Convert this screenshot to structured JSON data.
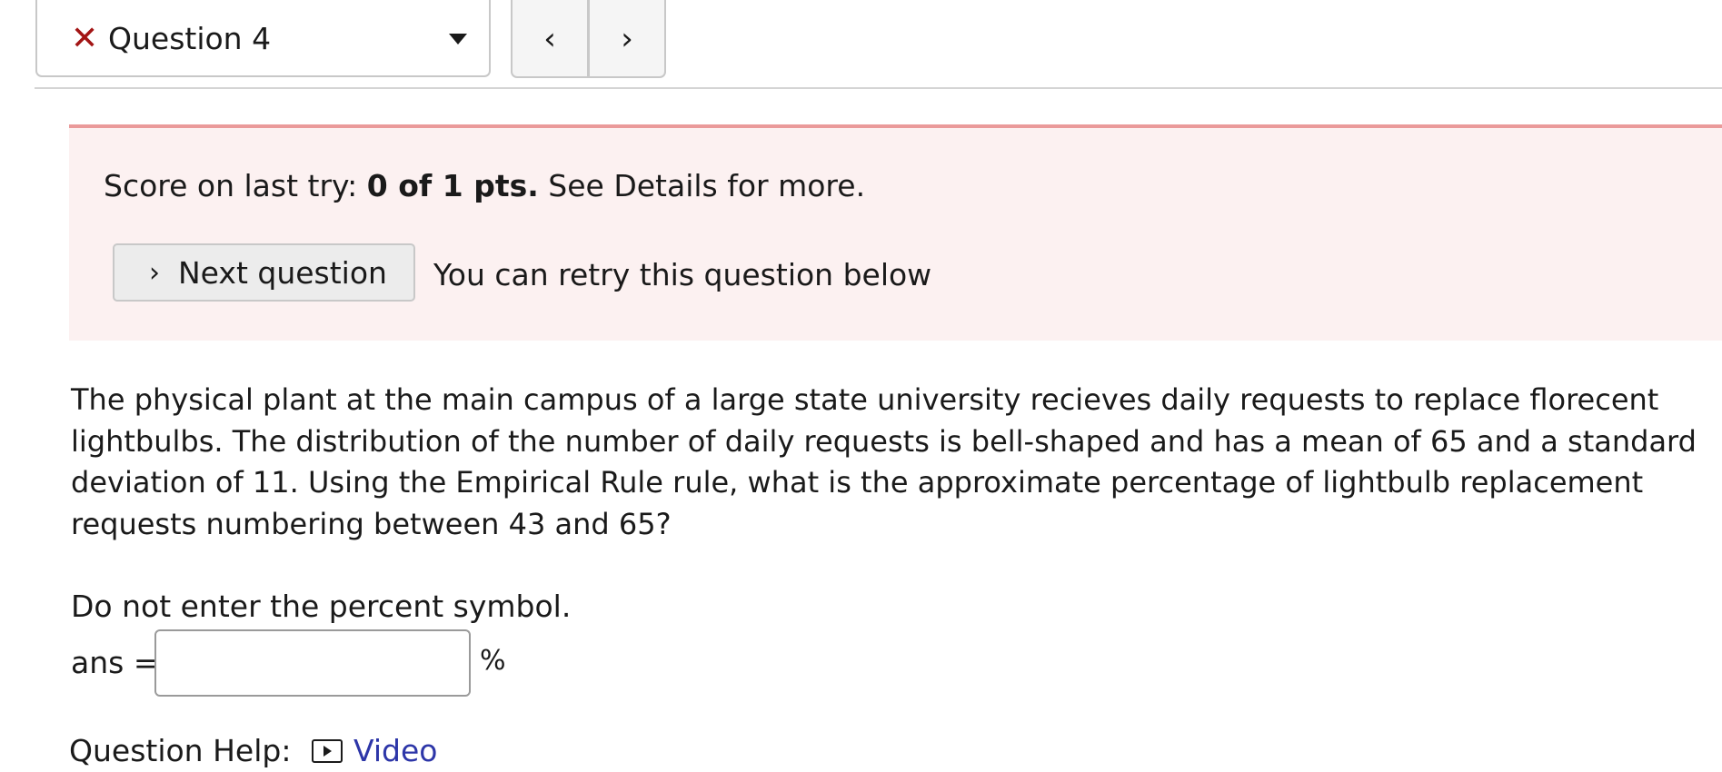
{
  "nav": {
    "question_label": "Question 4",
    "status_icon": "x-icon",
    "status_color": "#a31515",
    "prev_glyph": "‹",
    "next_glyph": "›"
  },
  "score_panel": {
    "prefix": "Score on last try:",
    "score": "0 of 1 pts.",
    "suffix": "See Details for more.",
    "next_button_label": "Next question",
    "retry_text": "You can retry this question below",
    "border_color": "#ea9a9a",
    "background": "#fcf1f1"
  },
  "question": {
    "text": "The physical plant at the main campus of a large state university recieves daily requests to replace florecent lightbulbs. The distribution of the number of daily requests is bell-shaped and has a mean of 65 and a standard deviation of 11. Using the Empirical Rule rule, what is the approximate percentage of lightbulb replacement requests numbering between 43 and 65?",
    "instruction": "Do not enter the percent symbol.",
    "answer_label": "ans =",
    "answer_value": "",
    "unit": "%"
  },
  "help": {
    "label": "Question Help:",
    "video_label": "Video",
    "link_color": "#2d36a8"
  }
}
